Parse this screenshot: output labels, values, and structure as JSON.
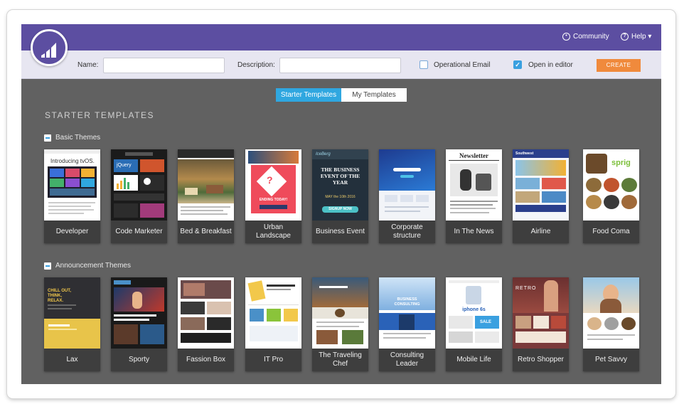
{
  "header": {
    "community_label": "Community",
    "help_label": "Help ▾"
  },
  "form": {
    "name_label": "Name:",
    "name_value": "",
    "description_label": "Description:",
    "description_value": "",
    "operational_label": "Operational Email",
    "operational_checked": false,
    "open_editor_label": "Open in editor",
    "open_editor_checked": true,
    "create_label": "CREATE"
  },
  "tabs": [
    {
      "label": "Starter Templates",
      "active": true
    },
    {
      "label": "My Templates",
      "active": false
    }
  ],
  "section_title": "STARTER TEMPLATES",
  "groups": [
    {
      "title": "Basic Themes",
      "templates": [
        {
          "label": "Developer",
          "thumb": {
            "intro": "Introducing tvOS."
          }
        },
        {
          "label": "Code Marketer",
          "thumb": {
            "brand": "jQuery"
          }
        },
        {
          "label": "Bed & Breakfast"
        },
        {
          "label": "Urban Landscape",
          "thumb": {
            "badge": "ENDING TODAY!"
          }
        },
        {
          "label": "Business Event",
          "thumb": {
            "brand": "IceBerg",
            "headline": "THE BUSINESS EVENT OF THE YEAR",
            "date": "MAY the 10th 2016",
            "cta": "SIGNUP NOW"
          }
        },
        {
          "label": "Corporate structure"
        },
        {
          "label": "In The News",
          "thumb": {
            "masthead": "Newsletter"
          }
        },
        {
          "label": "Airline",
          "thumb": {
            "brand": "Southwest"
          }
        },
        {
          "label": "Food Coma",
          "thumb": {
            "brand": "sprig"
          }
        }
      ]
    },
    {
      "title": "Announcement Themes",
      "templates": [
        {
          "label": "Lax",
          "thumb": {
            "headline": "CHILL OUT, THINK, RELAX."
          }
        },
        {
          "label": "Sporty"
        },
        {
          "label": "Fassion Box"
        },
        {
          "label": "IT Pro"
        },
        {
          "label": "The Traveling Chef"
        },
        {
          "label": "Consulting Leader",
          "thumb": {
            "headline": "BUSINESS CONSULTING"
          }
        },
        {
          "label": "Mobile Life",
          "thumb": {
            "product": "iphone 6s",
            "badge": "SALE"
          }
        },
        {
          "label": "Retro Shopper",
          "thumb": {
            "brand": "RETRO"
          }
        },
        {
          "label": "Pet Savvy"
        }
      ]
    }
  ],
  "colors": {
    "brand_purple": "#5c4ea1",
    "accent_blue": "#2fa7e0",
    "create_orange": "#f08a3c",
    "canvas_gray": "#616161"
  }
}
